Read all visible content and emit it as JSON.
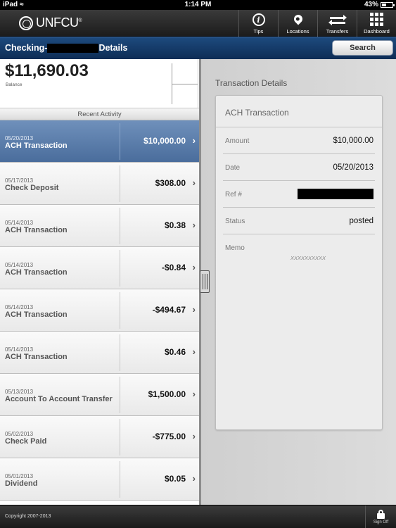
{
  "status_bar": {
    "carrier": "iPad",
    "time": "1:14 PM",
    "battery": "43%",
    "battery_level": 0.43
  },
  "header": {
    "logo_text": "UNFCU",
    "logo_mark": "®",
    "nav": [
      {
        "label": "Tips",
        "icon": "info-icon"
      },
      {
        "label": "Locations",
        "icon": "map-pin-icon"
      },
      {
        "label": "Transfers",
        "icon": "transfer-arrows-icon"
      },
      {
        "label": "Dashboard",
        "icon": "grid-icon"
      }
    ]
  },
  "sub_header": {
    "title_prefix": "Checking-",
    "title_suffix": "Details",
    "search_label": "Search"
  },
  "account": {
    "balance": "$11,690.03",
    "balance_label": "Balance"
  },
  "recent_activity_label": "Recent Activity",
  "transactions": [
    {
      "date": "05/20/2013",
      "description": "ACH Transaction",
      "amount": "$10,000.00",
      "selected": true
    },
    {
      "date": "05/17/2013",
      "description": "Check Deposit",
      "amount": "$308.00"
    },
    {
      "date": "05/14/2013",
      "description": "ACH Transaction",
      "amount": "$0.38"
    },
    {
      "date": "05/14/2013",
      "description": "ACH Transaction",
      "amount": "-$0.84"
    },
    {
      "date": "05/14/2013",
      "description": "ACH Transaction",
      "amount": "-$494.67"
    },
    {
      "date": "05/14/2013",
      "description": "ACH Transaction",
      "amount": "$0.46"
    },
    {
      "date": "05/13/2013",
      "description": "Account To Account Transfer",
      "amount": "$1,500.00"
    },
    {
      "date": "05/02/2013",
      "description": "Check Paid",
      "amount": "-$775.00"
    },
    {
      "date": "05/01/2013",
      "description": "Dividend",
      "amount": "$0.05"
    }
  ],
  "detail": {
    "section_title": "Transaction Details",
    "type": "ACH Transaction",
    "amount_label": "Amount",
    "amount": "$10,000.00",
    "date_label": "Date",
    "date": "05/20/2013",
    "ref_label": "Ref #",
    "status_label": "Status",
    "status": "posted",
    "memo_label": "Memo",
    "memo": "XXXXXXXXXX"
  },
  "footer": {
    "copyright": "Copyright 2007-2013",
    "signoff_label": "Sign Off"
  },
  "colors": {
    "brand_blue": "#0e2d55",
    "selected_row": "#4a6d9c"
  }
}
